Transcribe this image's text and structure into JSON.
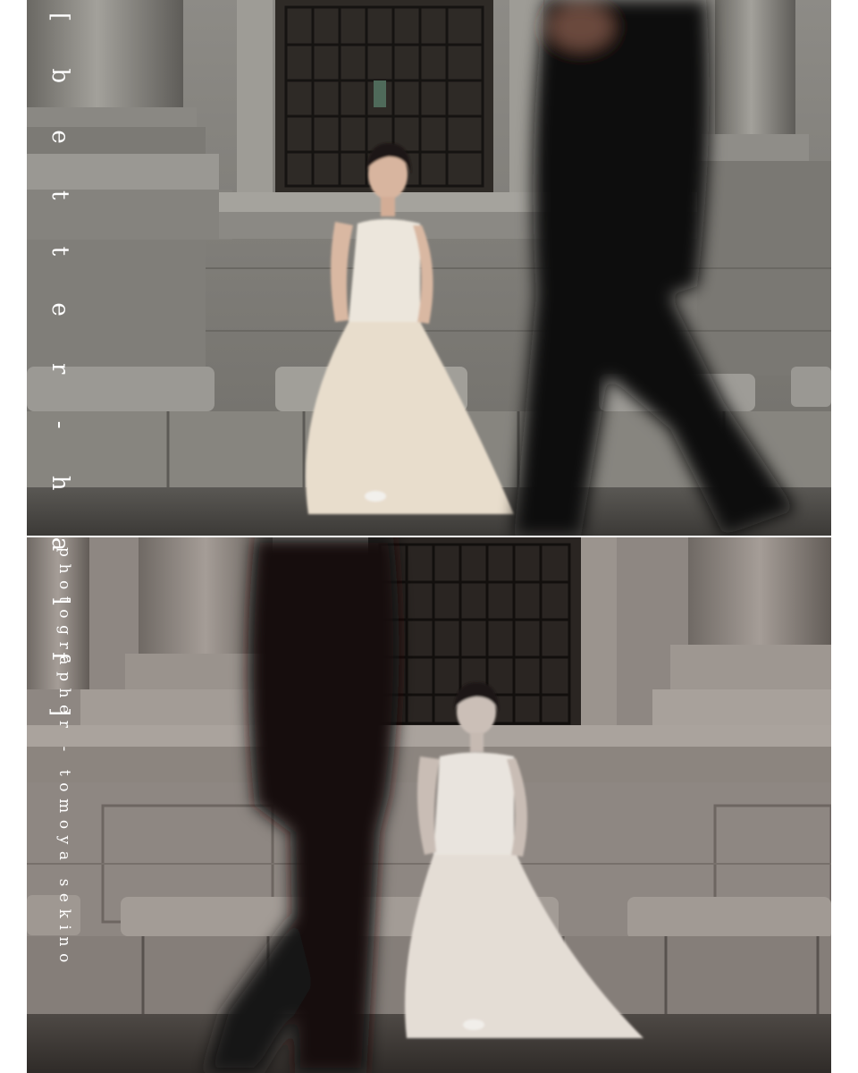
{
  "overlay": {
    "title": "[ b e t t e r - h a l f ]",
    "credit": "photographer - tomoya sekino"
  },
  "photos": [
    {
      "name": "color-photo",
      "tone": "color",
      "subject": "bride seated on stone bench, blurred passerby walking"
    },
    {
      "name": "sepia-photo",
      "tone": "desaturated",
      "subject": "bride seated on stone bench looking down, blurred passerby walking"
    }
  ],
  "colors": {
    "background": "#ffffff",
    "text": "#ffffff",
    "stone": "#8c8a85",
    "stone_dark": "#54524e",
    "dress": "#ece4d6",
    "figure": "#111111"
  }
}
